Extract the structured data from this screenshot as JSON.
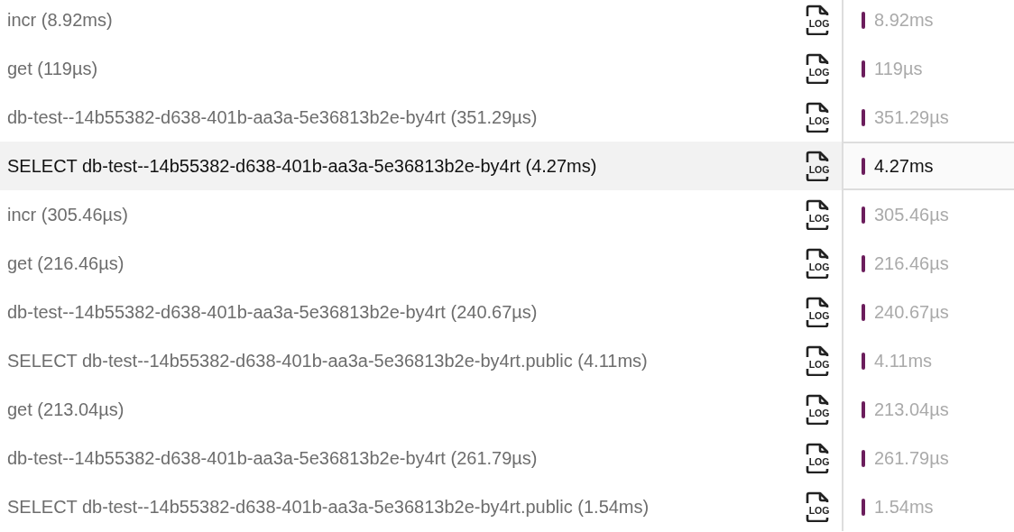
{
  "spans": [
    {
      "label": "incr (8.92ms)",
      "icon_text": "LOG",
      "duration": "8.92ms",
      "selected": false
    },
    {
      "label": "get (119µs)",
      "icon_text": "LOG",
      "duration": "119µs",
      "selected": false
    },
    {
      "label": "db-test--14b55382-d638-401b-aa3a-5e36813b2e-by4rt (351.29µs)",
      "icon_text": "LOG",
      "duration": "351.29µs",
      "selected": false
    },
    {
      "label": "SELECT db-test--14b55382-d638-401b-aa3a-5e36813b2e-by4rt (4.27ms)",
      "icon_text": "LOG",
      "duration": "4.27ms",
      "selected": true
    },
    {
      "label": "incr (305.46µs)",
      "icon_text": "LOG",
      "duration": "305.46µs",
      "selected": false
    },
    {
      "label": "get (216.46µs)",
      "icon_text": "LOG",
      "duration": "216.46µs",
      "selected": false
    },
    {
      "label": "db-test--14b55382-d638-401b-aa3a-5e36813b2e-by4rt (240.67µs)",
      "icon_text": "LOG",
      "duration": "240.67µs",
      "selected": false
    },
    {
      "label": "SELECT db-test--14b55382-d638-401b-aa3a-5e36813b2e-by4rt.public (4.11ms)",
      "icon_text": "LOG",
      "duration": "4.11ms",
      "selected": false
    },
    {
      "label": "get (213.04µs)",
      "icon_text": "LOG",
      "duration": "213.04µs",
      "selected": false
    },
    {
      "label": "db-test--14b55382-d638-401b-aa3a-5e36813b2e-by4rt (261.79µs)",
      "icon_text": "LOG",
      "duration": "261.79µs",
      "selected": false
    },
    {
      "label": "SELECT db-test--14b55382-d638-401b-aa3a-5e36813b2e-by4rt.public (1.54ms)",
      "icon_text": "LOG",
      "duration": "1.54ms",
      "selected": false
    }
  ]
}
